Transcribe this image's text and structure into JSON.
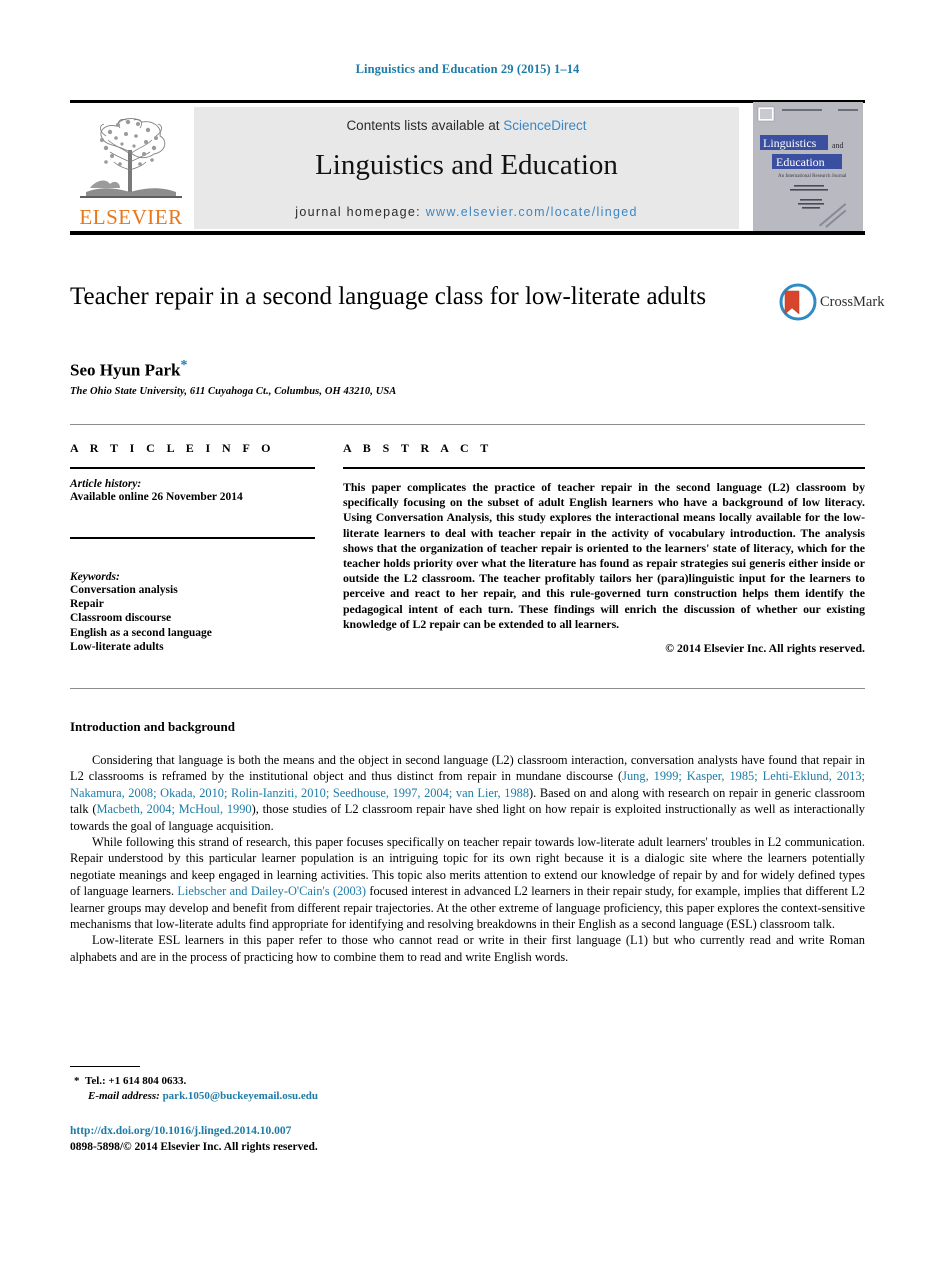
{
  "running_head": "Linguistics and Education 29 (2015) 1–14",
  "masthead": {
    "contents_prefix": "Contents lists available at ",
    "sciencedirect": "ScienceDirect",
    "journal_title": "Linguistics and Education",
    "homepage_prefix": "journal homepage: ",
    "homepage_url": "www.elsevier.com/locate/linged",
    "publisher": "ELSEVIER",
    "cover": {
      "line1": "Linguistics",
      "line1b": "and",
      "line2": "Education",
      "subtitle": "An International Research Journal"
    },
    "colors": {
      "link_blue": "#3c87c4",
      "elsevier_orange": "#e8761b",
      "band_gray": "#e8e8e8"
    }
  },
  "article": {
    "title": "Teacher repair in a second language class for low-literate adults",
    "author": "Seo Hyun Park",
    "author_marker": "*",
    "affiliation": "The Ohio State University, 611 Cuyahoga Ct., Columbus, OH 43210, USA",
    "crossmark_label": "CrossMark"
  },
  "info": {
    "heading": "A R T I C L E  I N F O",
    "history_label": "Article history:",
    "history_value": "Available online 26 November 2014",
    "keywords_label": "Keywords:",
    "keywords": [
      "Conversation analysis",
      "Repair",
      "Classroom discourse",
      "English as a second language",
      "Low-literate adults"
    ]
  },
  "abstract": {
    "heading": "A B S T R A C T",
    "text": "This paper complicates the practice of teacher repair in the second language (L2) classroom by specifically focusing on the subset of adult English learners who have a background of low literacy. Using Conversation Analysis, this study explores the interactional means locally available for the low-literate learners to deal with teacher repair in the activity of vocabulary introduction. The analysis shows that the organization of teacher repair is oriented to the learners' state of literacy, which for the teacher holds priority over what the literature has found as repair strategies sui generis either inside or outside the L2 classroom. The teacher profitably tailors her (para)linguistic input for the learners to perceive and react to her repair, and this rule-governed turn construction helps them identify the pedagogical intent of each turn. These findings will enrich the discussion of whether our existing knowledge of L2 repair can be extended to all learners.",
    "copyright": "© 2014 Elsevier Inc. All rights reserved."
  },
  "body": {
    "heading": "Introduction and background",
    "p1_a": "Considering that language is both the means and the object in second language (L2) classroom interaction, conversation analysts have found that repair in L2 classrooms is reframed by the institutional object and thus distinct from repair in mundane discourse (",
    "p1_cite1": "Jung, 1999; Kasper, 1985; Lehti-Eklund, 2013; Nakamura, 2008; Okada, 2010; Rolin-Ianziti, 2010; Seedhouse, 1997, 2004; van Lier, 1988",
    "p1_b": "). Based on and along with research on repair in generic classroom talk (",
    "p1_cite2": "Macbeth, 2004; McHoul, 1990",
    "p1_c": "), those studies of L2 classroom repair have shed light on how repair is exploited instructionally as well as interactionally towards the goal of language acquisition.",
    "p2_a": "While following this strand of research, this paper focuses specifically on teacher repair towards low-literate adult learners' troubles in L2 communication. Repair understood by this particular learner population is an intriguing topic for its own right because it is a dialogic site where the learners potentially negotiate meanings and keep engaged in learning activities. This topic also merits attention to extend our knowledge of repair by and for widely defined types of language learners. ",
    "p2_cite1": "Liebscher and Dailey-O'Cain's (2003)",
    "p2_b": " focused interest in advanced L2 learners in their repair study, for example, implies that different L2 learner groups may develop and benefit from different repair trajectories. At the other extreme of language proficiency, this paper explores the context-sensitive mechanisms that low-literate adults find appropriate for identifying and resolving breakdowns in their English as a second language (ESL) classroom talk.",
    "p3": "Low-literate ESL learners in this paper refer to those who cannot read or write in their first language (L1) but who currently read and write Roman alphabets and are in the process of practicing how to combine them to read and write English words."
  },
  "footer": {
    "tel_marker": "*",
    "tel": "Tel.: +1 614 804 0633.",
    "email_label": "E-mail address:",
    "email": "park.1050@buckeyemail.osu.edu",
    "doi": "http://dx.doi.org/10.1016/j.linged.2014.10.007",
    "issn": "0898-5898/© 2014 Elsevier Inc. All rights reserved."
  }
}
